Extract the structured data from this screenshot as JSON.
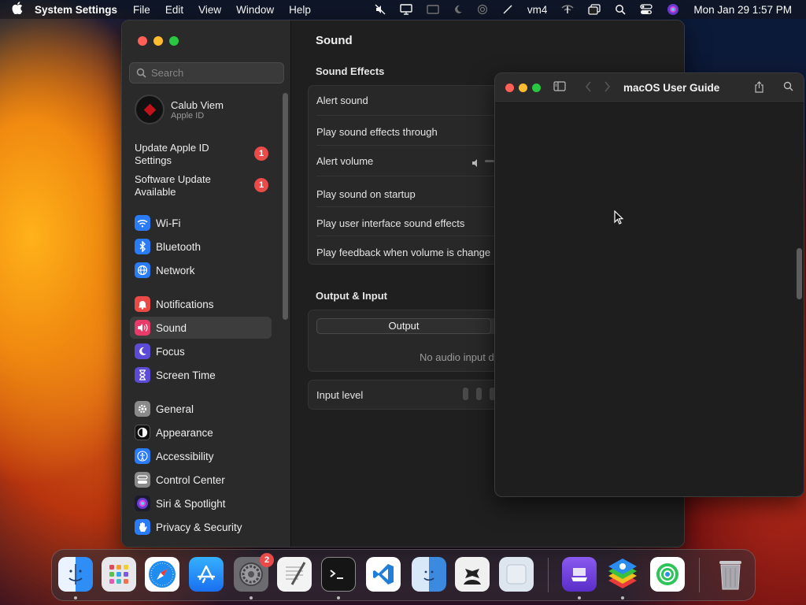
{
  "menubar": {
    "app_name": "System Settings",
    "menus": [
      "File",
      "Edit",
      "View",
      "Window",
      "Help"
    ],
    "status_text": "vm4",
    "datetime": "Mon Jan 29  1:57 PM"
  },
  "settings": {
    "search_placeholder": "Search",
    "profile": {
      "name": "Calub Viem",
      "subtitle": "Apple ID"
    },
    "alerts": [
      {
        "label": "Update Apple ID Settings",
        "count": "1"
      },
      {
        "label": "Software Update Available",
        "count": "1"
      }
    ],
    "sidebar": {
      "group1": [
        "Wi-Fi",
        "Bluetooth",
        "Network"
      ],
      "group2": [
        "Notifications",
        "Sound",
        "Focus",
        "Screen Time"
      ],
      "group3": [
        "General",
        "Appearance",
        "Accessibility",
        "Control Center",
        "Siri & Spotlight",
        "Privacy & Security"
      ],
      "active": "Sound"
    },
    "content": {
      "title": "Sound",
      "sound_effects_header": "Sound Effects",
      "rows": [
        "Alert sound",
        "Play sound effects through",
        "Alert volume",
        "Play sound on startup",
        "Play user interface sound effects",
        "Play feedback when volume is change"
      ],
      "output_input_header": "Output & Input",
      "tab_output": "Output",
      "no_audio": "No audio input d",
      "input_level": "Input level"
    }
  },
  "guide": {
    "title": "macOS User Guide"
  },
  "dock": {
    "apps": [
      "Finder",
      "Launchpad",
      "Safari",
      "App Store",
      "System Settings",
      "TextEdit",
      "Terminal",
      "Visual Studio Code",
      "Migration Assistant",
      "Bartender",
      "Preview",
      "Simulator",
      "BlueStacks",
      "Find My"
    ],
    "settings_badge": "2"
  },
  "colors": {
    "accent_red": "#e94b4b",
    "active_row": "#3d3d3d"
  }
}
